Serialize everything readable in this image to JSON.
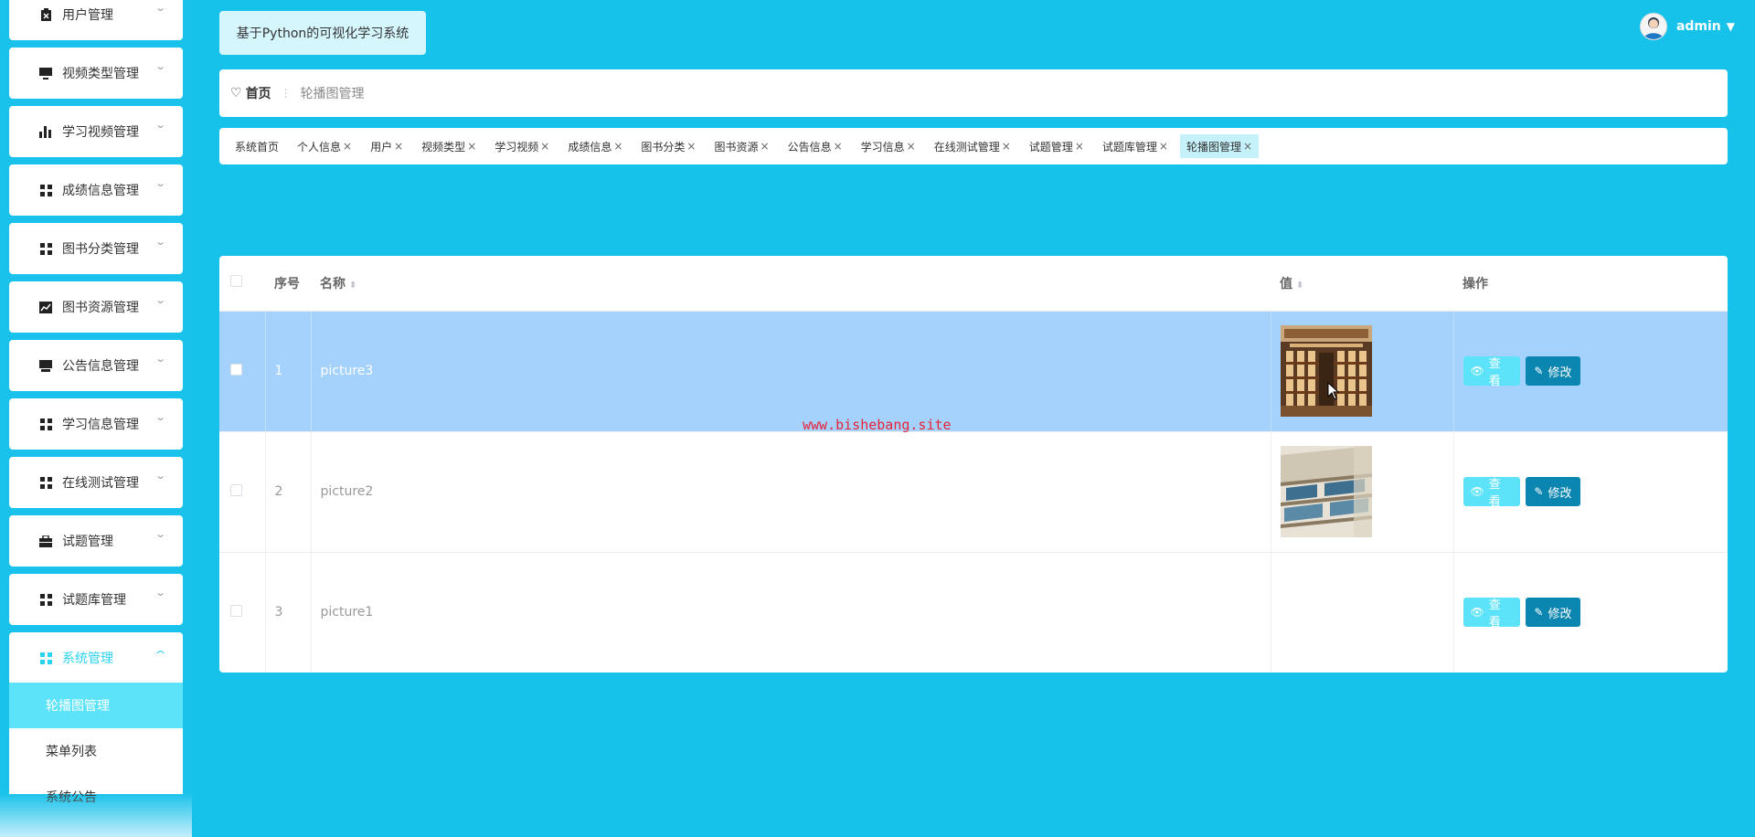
{
  "sidebar": {
    "items": [
      {
        "label": "用户管理",
        "icon": "clipboard-icon"
      },
      {
        "label": "视频类型管理",
        "icon": "monitor-icon"
      },
      {
        "label": "学习视频管理",
        "icon": "bar-chart-icon"
      },
      {
        "label": "成绩信息管理",
        "icon": "grid-icon"
      },
      {
        "label": "图书分类管理",
        "icon": "grid-icon"
      },
      {
        "label": "图书资源管理",
        "icon": "line-chart-icon"
      },
      {
        "label": "公告信息管理",
        "icon": "inbox-icon"
      },
      {
        "label": "学习信息管理",
        "icon": "grid-icon"
      },
      {
        "label": "在线测试管理",
        "icon": "grid-icon"
      },
      {
        "label": "试题管理",
        "icon": "briefcase-icon"
      },
      {
        "label": "试题库管理",
        "icon": "grid-icon"
      },
      {
        "label": "系统管理",
        "icon": "grid-icon"
      }
    ],
    "submenu": [
      {
        "label": "轮播图管理"
      },
      {
        "label": "菜单列表"
      },
      {
        "label": "系统公告"
      }
    ]
  },
  "header": {
    "system_title": "基于Python的可视化学习系统",
    "username": "admin"
  },
  "breadcrumb": {
    "home": "首页",
    "current": "轮播图管理"
  },
  "tags": [
    {
      "label": "系统首页"
    },
    {
      "label": "个人信息"
    },
    {
      "label": "用户"
    },
    {
      "label": "视频类型"
    },
    {
      "label": "学习视频"
    },
    {
      "label": "成绩信息"
    },
    {
      "label": "图书分类"
    },
    {
      "label": "图书资源"
    },
    {
      "label": "公告信息"
    },
    {
      "label": "学习信息"
    },
    {
      "label": "在线测试管理"
    },
    {
      "label": "试题管理"
    },
    {
      "label": "试题库管理"
    },
    {
      "label": "轮播图管理"
    }
  ],
  "table": {
    "headers": {
      "index": "序号",
      "name": "名称",
      "value": "值",
      "actions": "操作"
    },
    "rows": [
      {
        "index": "1",
        "name": "picture3",
        "has_image": true
      },
      {
        "index": "2",
        "name": "picture2",
        "has_image": true
      },
      {
        "index": "3",
        "name": "picture1",
        "has_image": false
      }
    ],
    "view_label": "查看",
    "edit_label": "修改"
  },
  "watermark": "www.bishebang.site",
  "colors": {
    "background": "#17c2ea",
    "accent": "#5ce3fa",
    "edit_button": "#0b86b0",
    "selected_row": "#a4d2fd"
  }
}
